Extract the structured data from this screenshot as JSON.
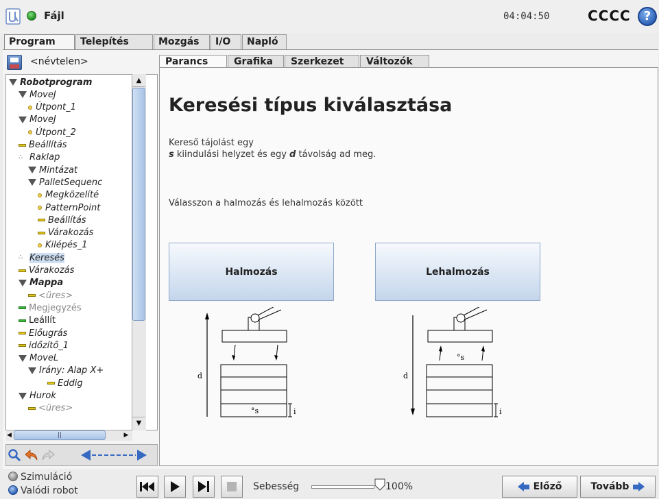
{
  "header": {
    "file_label": "Fájl",
    "clock": "04:04:50",
    "robot_name": "CCCC",
    "help": "?"
  },
  "main_tabs": [
    "Program",
    "Telepítés",
    "Mozgás",
    "I/O",
    "Napló"
  ],
  "program": {
    "name": "<névtelen>"
  },
  "tree": [
    {
      "label": "Robotprogram",
      "indent": 0,
      "icon": "triangle",
      "bold": true
    },
    {
      "label": "MoveJ",
      "indent": 1,
      "icon": "triangle"
    },
    {
      "label": "Útpont_1",
      "indent": 2,
      "icon": "dot"
    },
    {
      "label": "MoveJ",
      "indent": 1,
      "icon": "triangle"
    },
    {
      "label": "Útpont_2",
      "indent": 2,
      "icon": "dot"
    },
    {
      "label": "Beállítás",
      "indent": 1,
      "icon": "bar"
    },
    {
      "label": "Raklap",
      "indent": 1,
      "icon": "pallet"
    },
    {
      "label": "Mintázat",
      "indent": 2,
      "icon": "triangle"
    },
    {
      "label": "PalletSequenc",
      "indent": 2,
      "icon": "triangle"
    },
    {
      "label": "Megközelíté",
      "indent": 3,
      "icon": "dot"
    },
    {
      "label": "PatternPoint",
      "indent": 3,
      "icon": "dot"
    },
    {
      "label": "Beállítás",
      "indent": 3,
      "icon": "bar"
    },
    {
      "label": "Várakozás",
      "indent": 3,
      "icon": "bar"
    },
    {
      "label": "Kilépés_1",
      "indent": 3,
      "icon": "dot"
    },
    {
      "label": "Keresés",
      "indent": 1,
      "icon": "pallet",
      "selected": true
    },
    {
      "label": "Várakozás",
      "indent": 1,
      "icon": "bar"
    },
    {
      "label": "Mappa",
      "indent": 1,
      "icon": "triangle",
      "bold": true
    },
    {
      "label": "<üres>",
      "indent": 2,
      "icon": "bar",
      "grey": true
    },
    {
      "label": "Megjegyzés",
      "indent": 1,
      "icon": "bargreen",
      "grey": true,
      "upright": true
    },
    {
      "label": "Leállít",
      "indent": 1,
      "icon": "bargreen",
      "upright": true
    },
    {
      "label": "Előugrás",
      "indent": 1,
      "icon": "bar"
    },
    {
      "label": "időzítő_1",
      "indent": 1,
      "icon": "bar"
    },
    {
      "label": "MoveL",
      "indent": 1,
      "icon": "triangle"
    },
    {
      "label": "Irány: Alap X+",
      "indent": 2,
      "icon": "triangle"
    },
    {
      "label": "Eddig",
      "indent": 4,
      "icon": "bar"
    },
    {
      "label": "Hurok",
      "indent": 1,
      "icon": "triangle"
    },
    {
      "label": "<üres>",
      "indent": 2,
      "icon": "bar",
      "grey": true
    }
  ],
  "sub_tabs": [
    "Parancs",
    "Grafika",
    "Szerkezet",
    "Változók"
  ],
  "content": {
    "title": "Keresési típus kiválasztása",
    "desc_line1": "Kereső tájolást egy",
    "desc_s": "s",
    "desc_mid": " kiindulási helyzet és egy ",
    "desc_d": "d",
    "desc_end": " távolság ad meg.",
    "choose": "Válasszon a halmozás és lehalmozás között",
    "stack_button": "Halmozás",
    "destack_button": "Lehalmozás",
    "diagram_d": "d",
    "diagram_s": "°s",
    "diagram_i": "i"
  },
  "footer": {
    "simulation": "Szimuláció",
    "real_robot": "Valódi robot",
    "speed_label": "Sebesség",
    "speed_value": "100%",
    "speed_fraction": 1.0,
    "prev": "Előző",
    "next": "Tovább"
  }
}
